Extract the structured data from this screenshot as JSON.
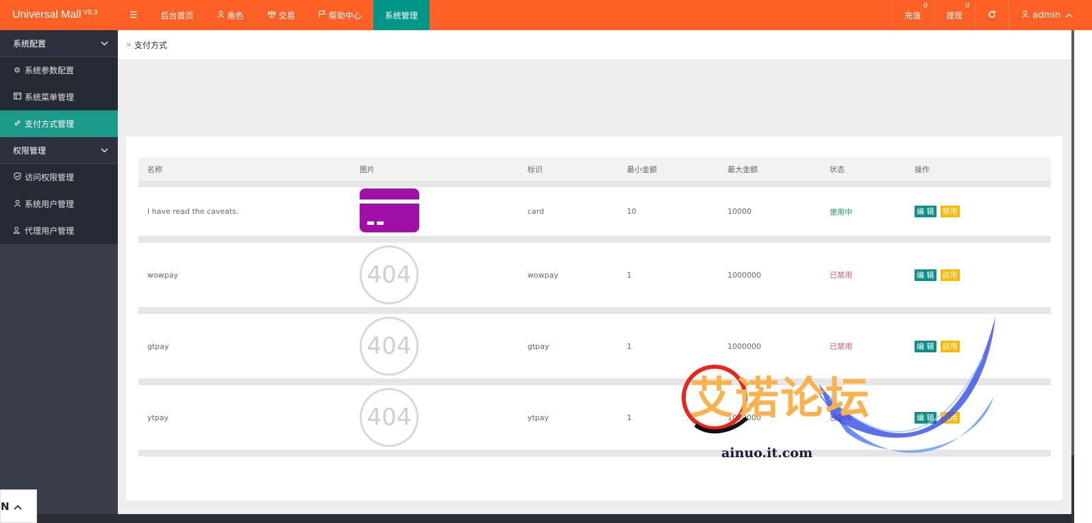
{
  "app": {
    "name": "Universal Mall",
    "version": "V8.3"
  },
  "topnav": {
    "menu_icon": "hamburger-icon",
    "items": [
      {
        "label": "后台首页",
        "icon": ""
      },
      {
        "label": "角色",
        "icon": "user-icon"
      },
      {
        "label": "交易",
        "icon": "scale-icon"
      },
      {
        "label": "帮助中心",
        "icon": "flag-icon"
      },
      {
        "label": "系统管理",
        "icon": "",
        "active": true
      }
    ],
    "right": {
      "recharge": {
        "label": "充值",
        "badge": "0"
      },
      "withdraw": {
        "label": "提现",
        "badge": "0"
      },
      "refresh_icon": "refresh-icon",
      "user": {
        "label": "admin",
        "icon": "user-icon"
      }
    }
  },
  "sidebar": {
    "groups": [
      {
        "label": "系统配置",
        "items": [
          {
            "label": "系统参数配置",
            "icon": "gear-icon"
          },
          {
            "label": "系统菜单管理",
            "icon": "window-icon"
          },
          {
            "label": "支付方式管理",
            "icon": "link-icon",
            "active": true
          }
        ]
      },
      {
        "label": "权限管理",
        "items": [
          {
            "label": "访问权限管理",
            "icon": "shield-icon"
          },
          {
            "label": "系统用户管理",
            "icon": "user-icon"
          },
          {
            "label": "代理用户管理",
            "icon": "user-group-icon"
          }
        ]
      }
    ]
  },
  "breadcrumb": {
    "current": "支付方式"
  },
  "table": {
    "columns": [
      "名称",
      "图片",
      "标识",
      "最小金额",
      "最大金额",
      "状态",
      "操作"
    ],
    "rows": [
      {
        "name": "I have read the caveats.",
        "image": "card",
        "code": "card",
        "min": "10",
        "max": "10000",
        "status": "使用中",
        "edit": "编 辑",
        "toggle": "禁用"
      },
      {
        "name": "wowpay",
        "image": "404",
        "code": "wowpay",
        "min": "1",
        "max": "1000000",
        "status": "已禁用",
        "edit": "编 辑",
        "toggle": "启用"
      },
      {
        "name": "gtpay",
        "image": "404",
        "code": "gtpay",
        "min": "1",
        "max": "1000000",
        "status": "已禁用",
        "edit": "编 辑",
        "toggle": "启用"
      },
      {
        "name": "ytpay",
        "image": "404",
        "code": "ytpay",
        "min": "1",
        "max": "1000000",
        "status": "已禁用",
        "edit": "编 辑",
        "toggle": "启用"
      }
    ],
    "img_404_text": "404"
  },
  "lang_widget": {
    "label": "N"
  },
  "watermark": {
    "title": "艾诺论坛",
    "url": "ainuo.it.com"
  },
  "colors": {
    "topbar": "#ff6026",
    "active_tab": "#009688",
    "sidebar": "#393d49",
    "edit_btn": "#0f8f86",
    "toggle_btn": "#ffb800",
    "status_on": "#1aa35a",
    "status_off": "#e25b5b",
    "card_image": "#a010a8"
  }
}
